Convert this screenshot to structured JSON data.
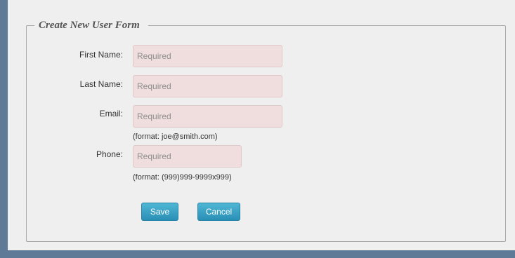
{
  "form": {
    "legend": "Create New User Form",
    "fields": [
      {
        "label": "First Name:",
        "placeholder": "Required",
        "value": ""
      },
      {
        "label": "Last Name:",
        "placeholder": "Required",
        "value": ""
      },
      {
        "label": "Email:",
        "placeholder": "Required",
        "value": "",
        "hint": "(format: joe@smith.com)"
      },
      {
        "label": "Phone:",
        "placeholder": "Required",
        "value": "",
        "hint": "(format: (999)999-9999x999)"
      }
    ],
    "buttons": {
      "save": "Save",
      "cancel": "Cancel"
    }
  },
  "colors": {
    "background_frame": "#5f7a96",
    "panel": "#efefef",
    "input_required_bg": "#f0dede",
    "button": "#31a2c6"
  }
}
